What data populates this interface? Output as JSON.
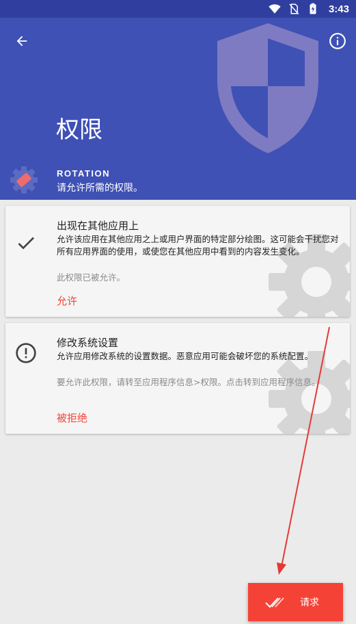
{
  "status_bar": {
    "time": "3:43",
    "icons": [
      "wifi-icon",
      "no-sim-icon",
      "battery-charging-icon"
    ]
  },
  "header": {
    "title": "权限",
    "app_name": "ROTATION",
    "subtitle": "请允许所需的权限。",
    "background_color": "#3f51b5",
    "icons": [
      "back-arrow-icon",
      "info-icon",
      "shield-icon",
      "app-rotation-icon"
    ]
  },
  "permissions": [
    {
      "title": "出现在其他应用上",
      "description": "允许该应用在其他应用之上或用户界面的特定部分绘图。这可能会干扰您对所有应用界面的使用，或使您在其他应用中看到的内容发生变化。",
      "note": "此权限已被允许。",
      "action": "允许",
      "status": "granted",
      "status_icon": "check-icon"
    },
    {
      "title": "修改系统设置",
      "description": "允许应用修改系统的设置数据。恶意应用可能会破坏您的系统配置。",
      "note": "要允许此权限，请转至应用程序信息>权限。点击转到应用程序信息。",
      "action": "被拒绝",
      "status": "denied",
      "status_icon": "alert-circle-icon"
    }
  ],
  "request_button": {
    "label": "请求",
    "icon": "double-check-icon",
    "color": "#f44336"
  },
  "accent_color": "#f44336"
}
